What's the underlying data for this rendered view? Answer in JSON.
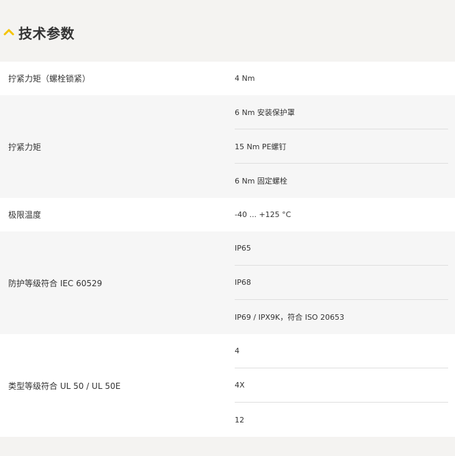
{
  "section": {
    "title": "技术参数",
    "accent_color": "#f5c400",
    "icon": "chevron-up-icon"
  },
  "specs": [
    {
      "label": "拧紧力矩（螺栓锁紧）",
      "values": [
        "4 Nm"
      ]
    },
    {
      "label": "拧紧力矩",
      "values": [
        "6 Nm 安装保护罩",
        "15 Nm PE螺钉",
        "6 Nm 固定螺栓"
      ]
    },
    {
      "label": "极限温度",
      "values": [
        "-40 ... +125 °C"
      ]
    },
    {
      "label": "防护等级符合 IEC 60529",
      "values": [
        "IP65",
        "IP68",
        "IP69 / IPX9K，符合 ISO 20653"
      ]
    },
    {
      "label": "类型等级符合 UL 50 / UL 50E",
      "values": [
        "4",
        "4X",
        "12"
      ]
    }
  ]
}
